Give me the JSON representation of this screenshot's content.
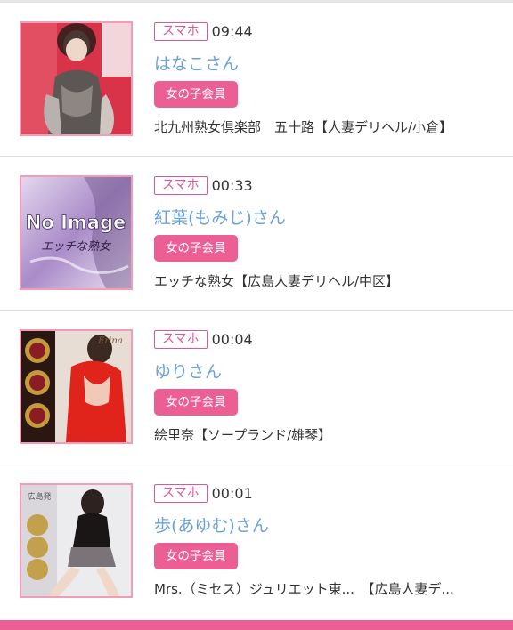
{
  "posts": [
    {
      "device": "スマホ",
      "time": "09:44",
      "name": "はなこさん",
      "member": "女の子会員",
      "shop": "北九州熟女倶楽部　五十路【人妻デリヘル/小倉】"
    },
    {
      "device": "スマホ",
      "time": "00:33",
      "name": "紅葉(もみじ)さん",
      "member": "女の子会員",
      "shop": "エッチな熟女【広島人妻デリヘル/中区】",
      "thumb_text": "No Image",
      "thumb_subtext": "エッチな熟女"
    },
    {
      "device": "スマホ",
      "time": "00:04",
      "name": "ゆりさん",
      "member": "女の子会員",
      "shop": "絵里奈【ソープランド/雄琴】",
      "thumb_text": "Erina"
    },
    {
      "device": "スマホ",
      "time": "00:01",
      "name": "歩(あゆむ)さん",
      "member": "女の子会員",
      "shop": "Mrs.（ミセス）ジュリエット東...　【広島人妻デ...",
      "thumb_text": "広島発"
    }
  ],
  "colors": {
    "accent_pink": "#ec5f94",
    "badge_border": "#e0569a",
    "name_blue": "#6aa1d8",
    "thumb_border": "#f39cb8"
  }
}
